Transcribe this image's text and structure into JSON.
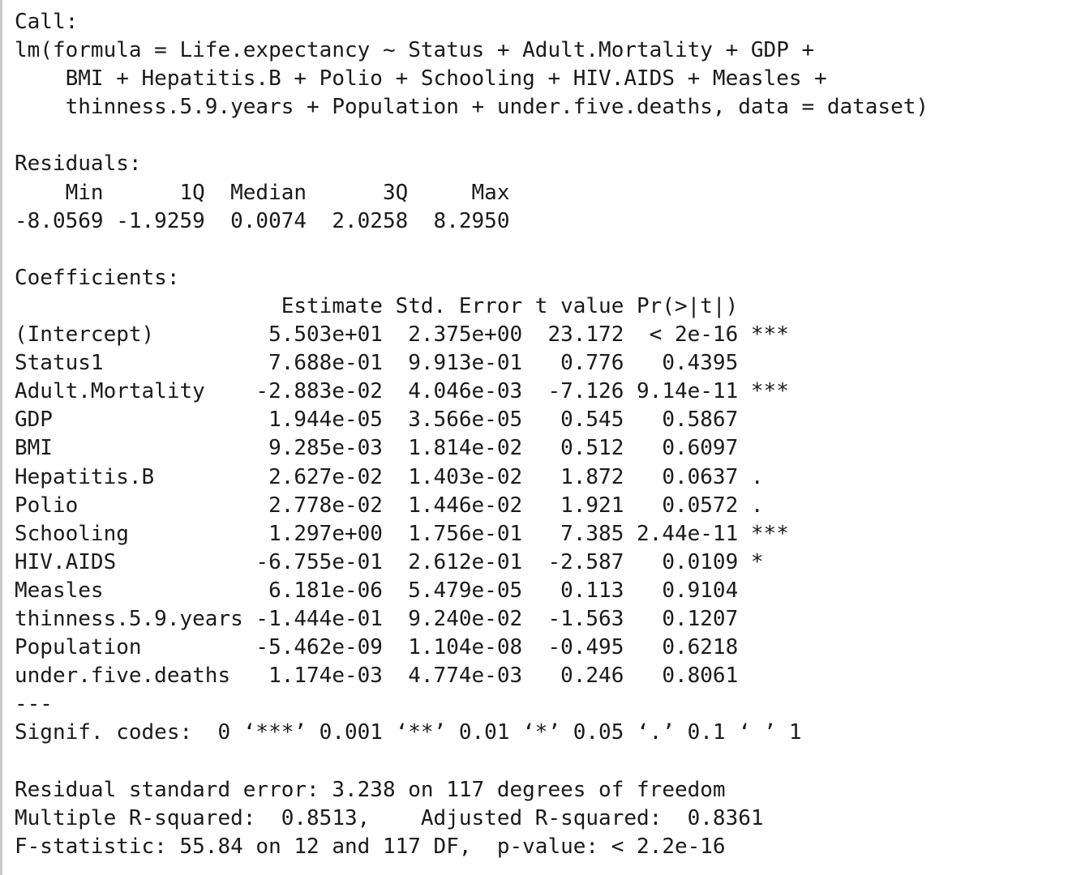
{
  "console": {
    "lines": [
      "Call:",
      "lm(formula = Life.expectancy ~ Status + Adult.Mortality + GDP +",
      "    BMI + Hepatitis.B + Polio + Schooling + HIV.AIDS + Measles +",
      "    thinness.5.9.years + Population + under.five.deaths, data = dataset)",
      "",
      "Residuals:",
      "    Min      1Q  Median      3Q     Max",
      "-8.0569 -1.9259  0.0074  2.0258  8.2950",
      "",
      "Coefficients:",
      "                     Estimate Std. Error t value Pr(>|t|)",
      "(Intercept)         5.503e+01  2.375e+00  23.172  < 2e-16 ***",
      "Status1             7.688e-01  9.913e-01   0.776   0.4395",
      "Adult.Mortality    -2.883e-02  4.046e-03  -7.126 9.14e-11 ***",
      "GDP                 1.944e-05  3.566e-05   0.545   0.5867",
      "BMI                 9.285e-03  1.814e-02   0.512   0.6097",
      "Hepatitis.B         2.627e-02  1.403e-02   1.872   0.0637 .",
      "Polio               2.778e-02  1.446e-02   1.921   0.0572 .",
      "Schooling           1.297e+00  1.756e-01   7.385 2.44e-11 ***",
      "HIV.AIDS           -6.755e-01  2.612e-01  -2.587   0.0109 *",
      "Measles             6.181e-06  5.479e-05   0.113   0.9104",
      "thinness.5.9.years -1.444e-01  9.240e-02  -1.563   0.1207",
      "Population         -5.462e-09  1.104e-08  -0.495   0.6218",
      "under.five.deaths   1.174e-03  4.774e-03   0.246   0.8061",
      "---",
      "Signif. codes:  0 ‘***’ 0.001 ‘**’ 0.01 ‘*’ 0.05 ‘.’ 0.1 ‘ ’ 1",
      "",
      "Residual standard error: 3.238 on 117 degrees of freedom",
      "Multiple R-squared:  0.8513,\tAdjusted R-squared:  0.8361 ",
      "F-statistic: 55.84 on 12 and 117 DF,  p-value: < 2.2e-16"
    ]
  }
}
